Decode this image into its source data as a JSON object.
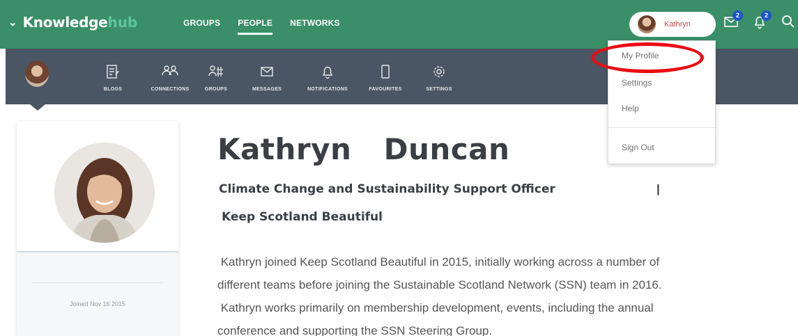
{
  "brand": {
    "part1": "Knowledge",
    "part2": "hub"
  },
  "topnav": {
    "items": [
      "GROUPS",
      "PEOPLE",
      "NETWORKS"
    ],
    "active": "PEOPLE"
  },
  "user": {
    "name": "Kathryn"
  },
  "badges": {
    "messages": "2",
    "notifications": "2"
  },
  "subnav": {
    "items": [
      "BLOGS",
      "CONNECTIONS",
      "GROUPS",
      "MESSAGES",
      "NOTIFICATIONS",
      "FAVOURITES",
      "SETTINGS"
    ]
  },
  "dropdown": {
    "items": [
      "My Profile",
      "Settings",
      "Help",
      "Sign Out"
    ]
  },
  "profile": {
    "name": "Kathryn  Duncan",
    "role": "Climate Change and Sustainability Support Officer",
    "separator": "|",
    "org": "Keep Scotland Beautiful",
    "joined": "Joined Nov 16 2015",
    "bio_lines": [
      " Kathryn joined Keep Scotland Beautiful in 2015, initially working across a number of",
      "different teams before joining the Sustainable Scotland Network (SSN) team in 2016.",
      " Kathryn works primarily on membership development, events, including the annual",
      "conference and supporting the SSN Steering Group."
    ]
  },
  "colors": {
    "topbar": "#3a8f68",
    "subbar": "#4a5663",
    "highlight": "#ea0d13",
    "badge": "#1e56c8"
  }
}
